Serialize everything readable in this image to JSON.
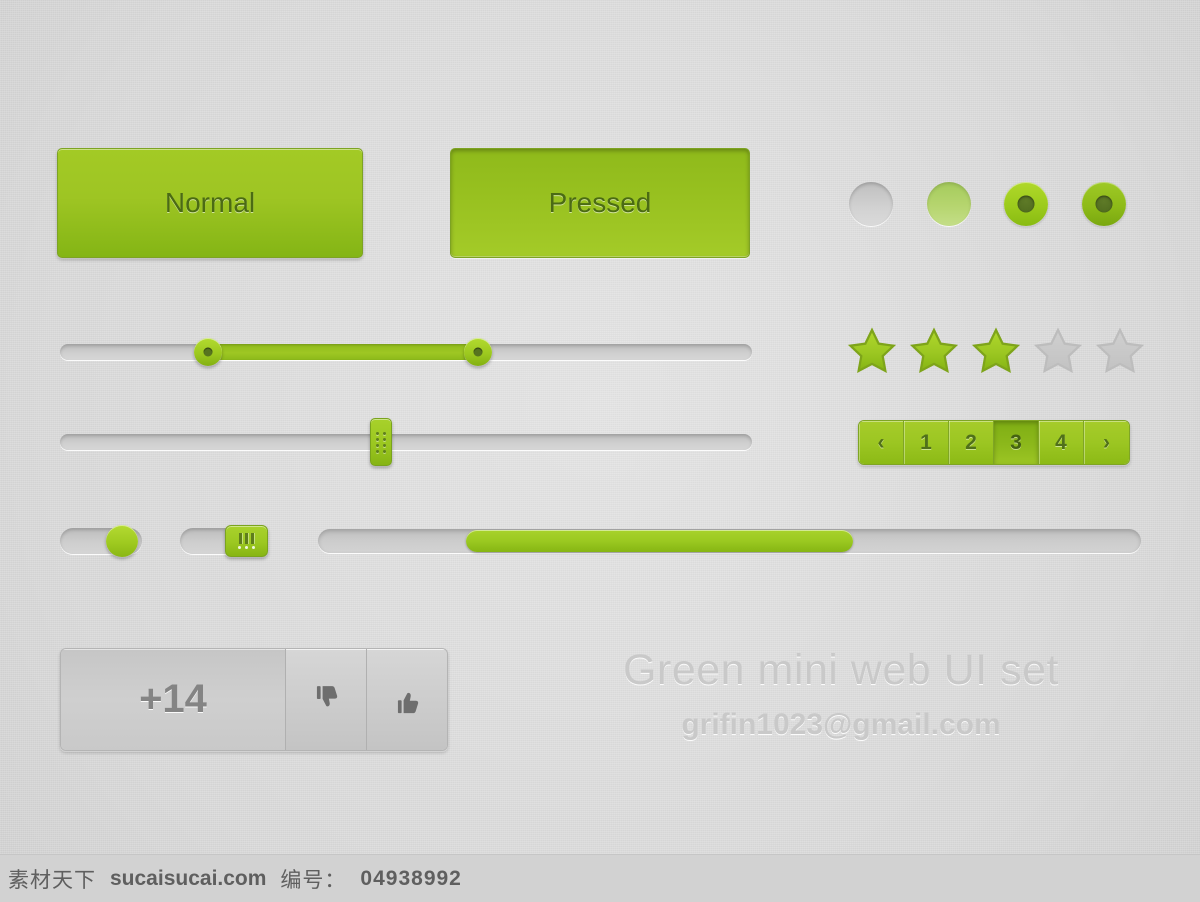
{
  "theme": {
    "background": "#dcdcdc",
    "accent_green": "#9cc722",
    "accent_green_dark": "#86b513",
    "accent_green_light": "#b3da30",
    "gray_track": "#cccccc",
    "text_gray": "#848484",
    "title_gray": "#c9c9c9"
  },
  "buttons": {
    "normal_label": "Normal",
    "pressed_label": "Pressed"
  },
  "radios": [
    {
      "name": "radio-off",
      "state": "unselected",
      "color": "#d2d2d2"
    },
    {
      "name": "radio-hover",
      "state": "hover",
      "color": "#b6d56f"
    },
    {
      "name": "radio-selected",
      "state": "selected",
      "color": "#9ccb1c"
    },
    {
      "name": "radio-selected-dark",
      "state": "selected-dark",
      "color": "#8ebb18"
    }
  ],
  "rating": {
    "value": 3,
    "max": 5,
    "filled_color": "#9cc722",
    "empty_color": "#c8c8c8"
  },
  "pagination": {
    "prev_label": "‹",
    "next_label": "›",
    "pages": [
      "1",
      "2",
      "3",
      "4"
    ],
    "active_page": "3"
  },
  "range_slider": {
    "name": "range-slider",
    "min_handle_pct": 21,
    "max_handle_pct": 60
  },
  "single_slider": {
    "name": "single-slider",
    "handle_pct": 46
  },
  "toggles": [
    {
      "name": "toggle-round",
      "state": "on"
    },
    {
      "name": "toggle-square",
      "state": "on"
    }
  ],
  "progress": {
    "name": "progress-scrollbar",
    "thumb_start_pct": 18,
    "thumb_width_pct": 47
  },
  "vote": {
    "count_label": "+14",
    "downvote_icon": "thumbs-down-icon",
    "upvote_icon": "thumbs-up-icon"
  },
  "branding": {
    "title": "Green mini web UI set",
    "email": "grifin1023@gmail.com"
  },
  "watermark": {
    "site_cn": "素材天下",
    "site": "sucaisucai.com",
    "id_label": "编号：",
    "id_value": "04938992"
  }
}
